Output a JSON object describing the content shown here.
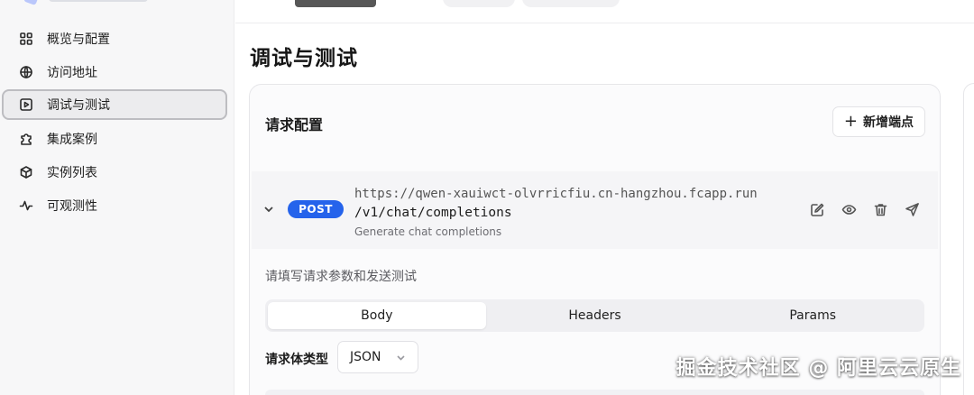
{
  "sidebar": {
    "items": [
      {
        "label": "概览与配置",
        "icon": "grid-icon"
      },
      {
        "label": "访问地址",
        "icon": "globe-icon"
      },
      {
        "label": "调试与测试",
        "icon": "play-square-icon"
      },
      {
        "label": "集成案例",
        "icon": "puzzle-icon"
      },
      {
        "label": "实例列表",
        "icon": "cube-icon"
      },
      {
        "label": "可观测性",
        "icon": "activity-icon"
      }
    ],
    "active": "调试与测试"
  },
  "main": {
    "title": "调试与测试",
    "card": {
      "title": "请求配置",
      "add_button": "新增端点",
      "endpoint": {
        "method": "POST",
        "url_line1": "https://qwen-xauiwct-olvrricfiu.cn-hangzhou.fcapp.run",
        "url_line2": "/v1/chat/completions",
        "description": "Generate chat completions"
      },
      "hint": "请填写请求参数和发送测试",
      "tabs": [
        "Body",
        "Headers",
        "Params"
      ],
      "active_tab": "Body",
      "body_type_label": "请求体类型",
      "body_type_value": "JSON"
    }
  },
  "watermark": "掘金技术社区 @ 阿里云云原生",
  "colors": {
    "accent": "#2563eb",
    "sidebar_bg": "#f7f7f8",
    "active_nav_bg": "#ececee"
  }
}
